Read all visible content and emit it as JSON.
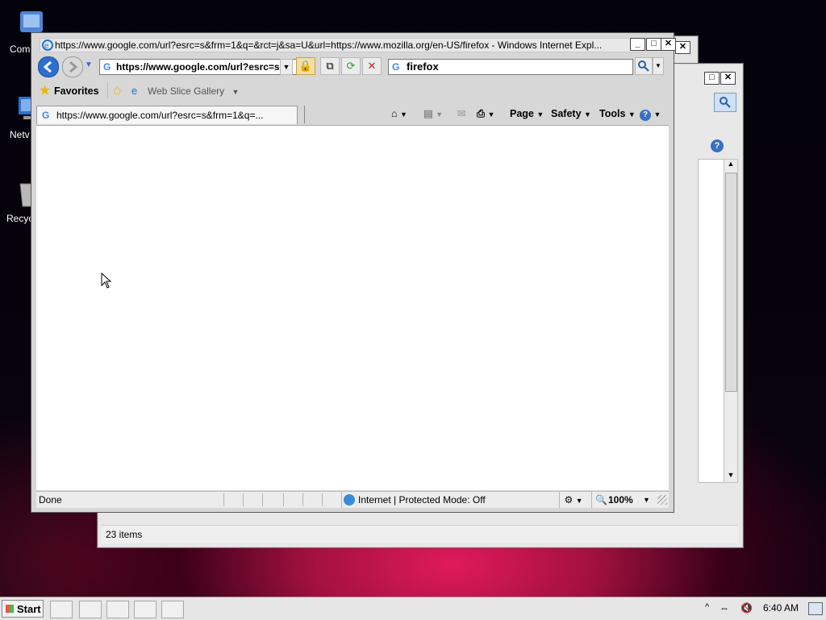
{
  "desktop": {
    "icons": [
      {
        "label": "Com"
      },
      {
        "label": "Netv"
      },
      {
        "label": "Recyc"
      }
    ]
  },
  "explorer_back": {
    "status_text": "23 items"
  },
  "ie": {
    "title": "https://www.google.com/url?esrc=s&frm=1&q=&rct=j&sa=U&url=https://www.mozilla.org/en-US/firefox - Windows Internet Expl...",
    "address": "https://www.google.com/url?esrc=s",
    "search_query": "firefox",
    "favorites_label": "Favorites",
    "web_slice_label": "Web Slice Gallery",
    "tab_label": "https://www.google.com/url?esrc=s&frm=1&q=...",
    "commands": {
      "page": "Page",
      "safety": "Safety",
      "tools": "Tools"
    },
    "status": {
      "left": "Done",
      "zone": "Internet | Protected Mode: Off",
      "zoom": "100%"
    }
  },
  "taskbar": {
    "start_label": "Start",
    "clock": "6:40 AM"
  }
}
